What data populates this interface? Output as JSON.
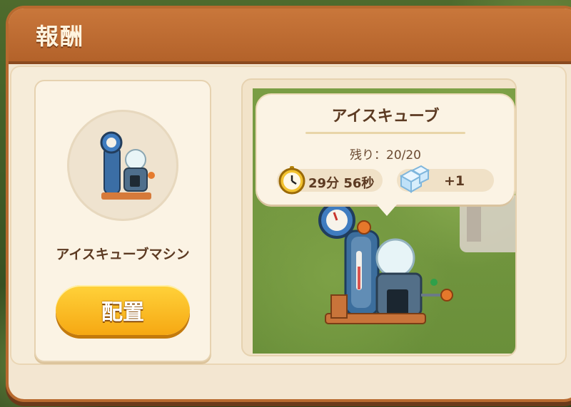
{
  "window": {
    "title": "報酬"
  },
  "reward_item": {
    "name": "アイスキューブマシン",
    "place_button_label": "配置"
  },
  "tooltip": {
    "title": "アイスキューブ",
    "remaining": "残り：20/20",
    "time": "29分 56秒",
    "reward": "+1",
    "icons": {
      "timer": "stopwatch-icon",
      "reward": "ice-cube-icon"
    }
  },
  "colors": {
    "header": "#b86a2f",
    "button": "#f8b81d",
    "panel": "#f3e6d1"
  }
}
